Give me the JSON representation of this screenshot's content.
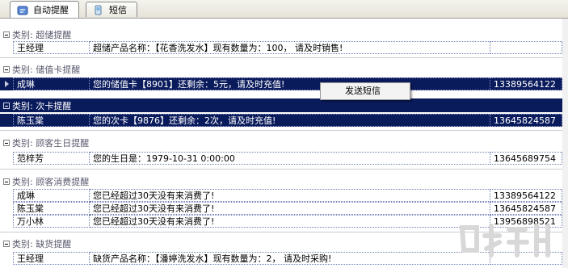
{
  "tabs": [
    {
      "label": "自动提醒",
      "icon": "clock-icon",
      "active": true
    },
    {
      "label": "短信",
      "icon": "sms-icon",
      "active": false
    }
  ],
  "groups": [
    {
      "label": "类别: 超储提醒",
      "rows": [
        {
          "name": "王经理",
          "message": "超储产品名称：【花香洗发水】现有数量为：100， 请及时销售!",
          "phone": ""
        }
      ]
    },
    {
      "label": "类别: 储值卡提醒",
      "rows": [
        {
          "name": "成琳",
          "message": "您的储值卡【8901】还剩余：5元，请及时充值!",
          "phone": "13389564122"
        }
      ]
    },
    {
      "label": "类别: 次卡提醒",
      "rows": [
        {
          "name": "陈玉棠",
          "message": "您的次卡【9876】还剩余：2次，请及时充值!",
          "phone": "13645824587"
        }
      ]
    },
    {
      "label": "类别: 顾客生日提醒",
      "rows": [
        {
          "name": "范梓芳",
          "message": "您的生日是：1979-10-31 0:00:00",
          "phone": "13645689754"
        }
      ]
    },
    {
      "label": "类别: 顾客消费提醒",
      "rows": [
        {
          "name": "成琳",
          "message": "您已经超过30天没有来消费了!",
          "phone": "13389564122"
        },
        {
          "name": "陈玉棠",
          "message": "您已经超过30天没有来消费了!",
          "phone": "13645824587"
        },
        {
          "name": "万小林",
          "message": "您已经超过30天没有来消费了!",
          "phone": "13956898521"
        }
      ]
    },
    {
      "label": "类别: 缺货提醒",
      "rows": [
        {
          "name": "王经理",
          "message": "缺货产品名称：【潘婷洗发水】现有数量为：2， 请及时采购!",
          "phone": ""
        }
      ]
    }
  ],
  "context_menu": {
    "item": "发送短信"
  },
  "colors": {
    "selection": "#0a1b5c",
    "group_text": "#5a5a6e"
  }
}
